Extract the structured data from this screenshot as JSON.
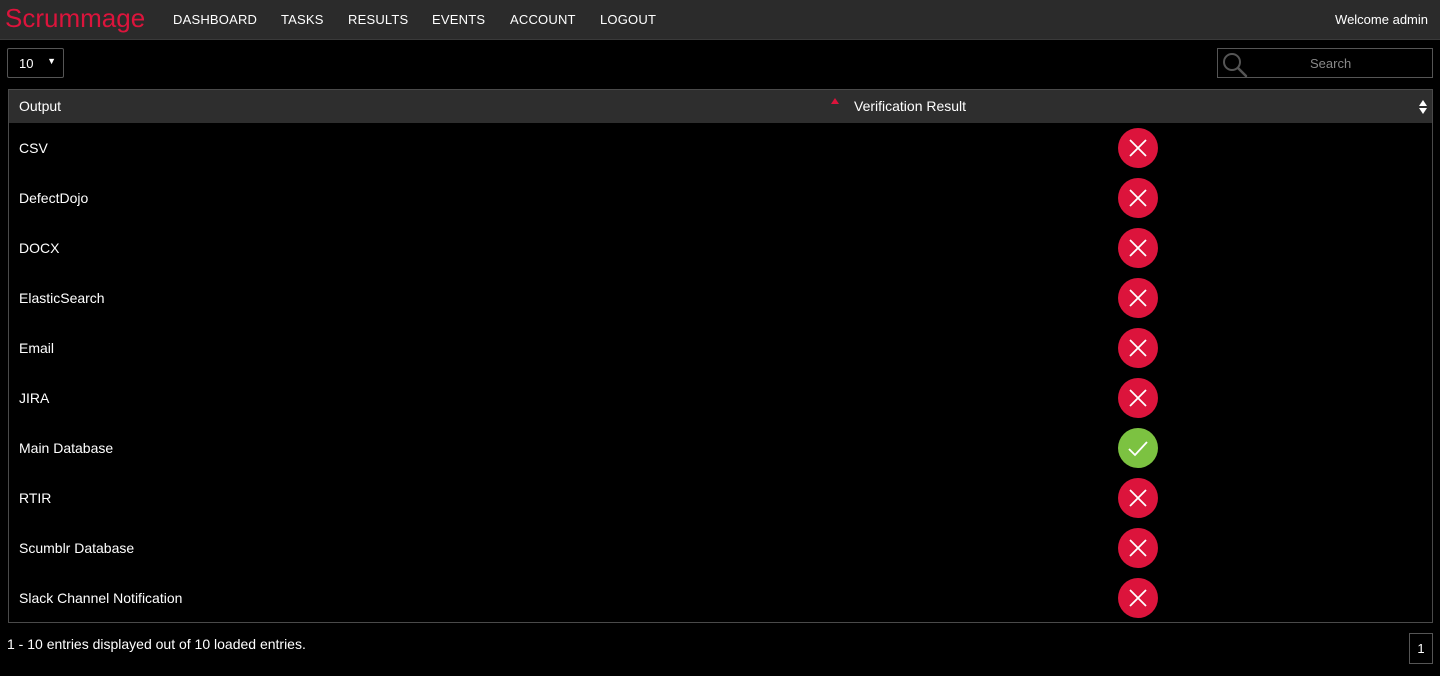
{
  "navbar": {
    "brand": "Scrummage",
    "items": [
      {
        "label": "DASHBOARD"
      },
      {
        "label": "TASKS"
      },
      {
        "label": "RESULTS"
      },
      {
        "label": "EVENTS"
      },
      {
        "label": "ACCOUNT"
      },
      {
        "label": "LOGOUT"
      }
    ],
    "welcome": "Welcome admin"
  },
  "controls": {
    "page_length": "10",
    "search_placeholder": "Search"
  },
  "table": {
    "headers": {
      "output": "Output",
      "verification": "Verification Result"
    },
    "sort": {
      "column": "Output",
      "direction": "ascending"
    },
    "rows": [
      {
        "output": "CSV",
        "verified": false
      },
      {
        "output": "DefectDojo",
        "verified": false
      },
      {
        "output": "DOCX",
        "verified": false
      },
      {
        "output": "ElasticSearch",
        "verified": false
      },
      {
        "output": "Email",
        "verified": false
      },
      {
        "output": "JIRA",
        "verified": false
      },
      {
        "output": "Main Database",
        "verified": true
      },
      {
        "output": "RTIR",
        "verified": false
      },
      {
        "output": "Scumblr Database",
        "verified": false
      },
      {
        "output": "Slack Channel Notification",
        "verified": false
      }
    ]
  },
  "footer": {
    "info": "1 - 10 entries displayed out of 10 loaded entries.",
    "current_page": "1"
  },
  "colors": {
    "brand": "#dc143c",
    "fail": "#dc143c",
    "ok": "#7cc241",
    "navbar_bg": "#2b2b2b",
    "header_bg": "#2e2e2e"
  },
  "icons": {
    "fail": "close-icon",
    "ok": "check-icon",
    "search": "search-icon"
  }
}
